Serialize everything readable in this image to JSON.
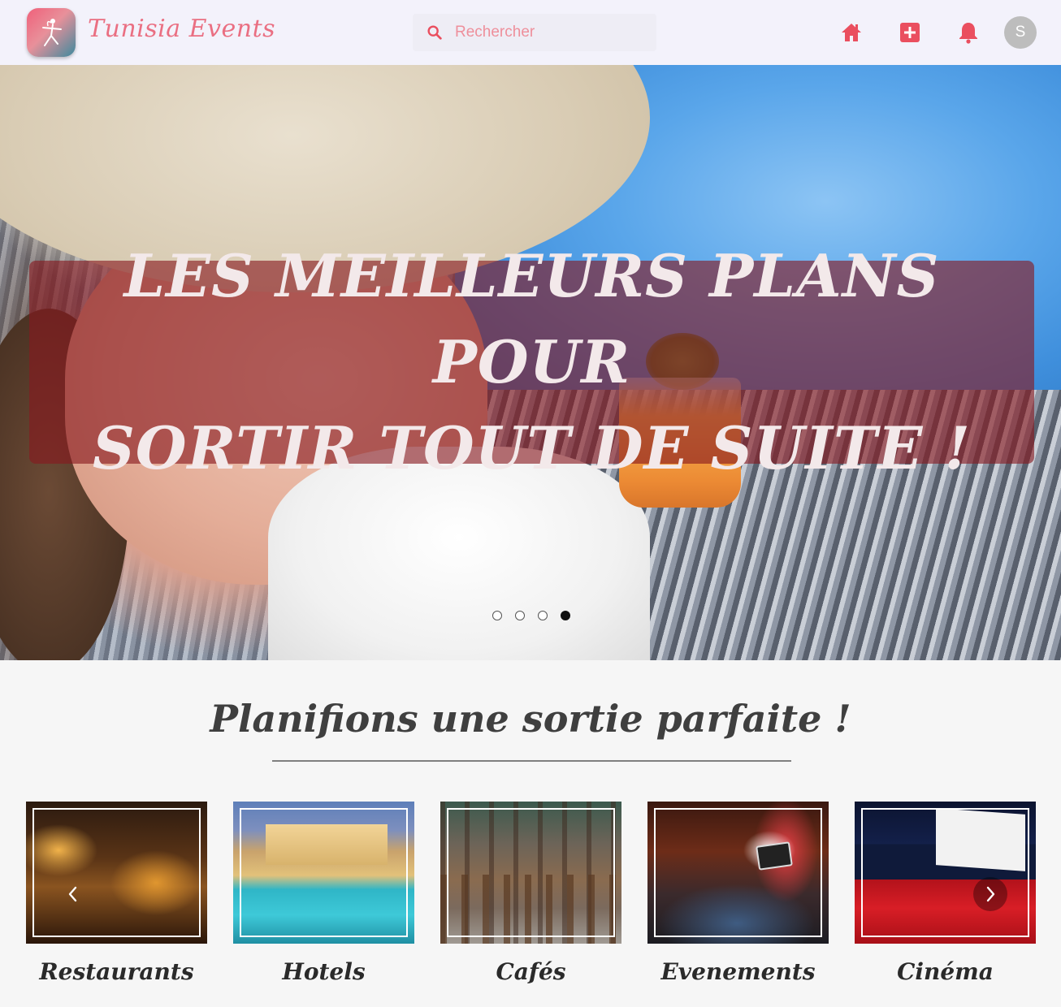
{
  "app": {
    "brand": "Tunisia Events"
  },
  "search": {
    "placeholder": "Rechercher"
  },
  "header": {
    "avatar_initial": "S"
  },
  "hero": {
    "line1": "LES MEILLEURS PLANS POUR",
    "line2": "SORTIR TOUT DE SUITE !",
    "slide_count": 4,
    "active_slide": 4
  },
  "section": {
    "title": "Planifions une sortie parfaite !"
  },
  "categories": [
    {
      "label": "Restaurants"
    },
    {
      "label": "Hotels"
    },
    {
      "label": "Cafés"
    },
    {
      "label": "Evenements"
    },
    {
      "label": "Cinéma"
    }
  ],
  "colors": {
    "accent": "#ea4f5f",
    "banner": "#87191e",
    "nav_bg": "#f3f2fb"
  }
}
